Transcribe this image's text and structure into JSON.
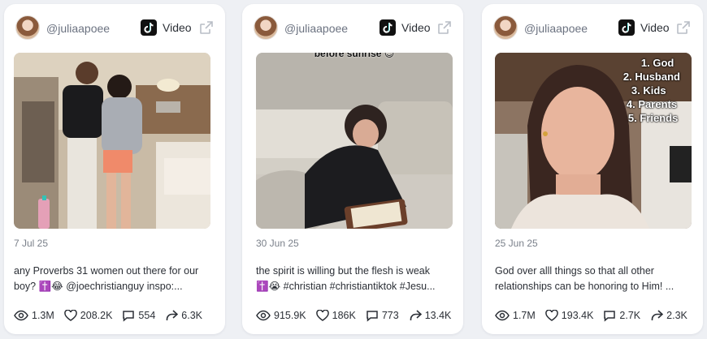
{
  "cards": [
    {
      "handle": "@juliaapoee",
      "type_label": "Video",
      "date": "7 Jul 25",
      "caption_1": "any Proverbs 31 women out there for our",
      "caption_2": "boy? ✝️😂 @joechristianguy inspo:...",
      "overlay_text": "",
      "views": "1.3M",
      "likes": "208.2K",
      "comments": "554",
      "shares": "6.3K"
    },
    {
      "handle": "@juliaapoee",
      "type_label": "Video",
      "date": "30 Jun 25",
      "caption_1": "the spirit is willing but the flesh is weak",
      "caption_2": "✝️😭 #christian #christiantiktok #Jesu...",
      "overlay_text": "before sunrise 😉",
      "views": "915.9K",
      "likes": "186K",
      "comments": "773",
      "shares": "13.4K"
    },
    {
      "handle": "@juliaapoee",
      "type_label": "Video",
      "date": "25 Jun 25",
      "caption_1": "God over alll things so that all other",
      "caption_2": "relationships can be honoring to Him! ...",
      "overlay_list": [
        "1. God",
        "2. Husband",
        "3. Kids",
        "4. Parents",
        "5. Friends"
      ],
      "views": "1.7M",
      "likes": "193.4K",
      "comments": "2.7K",
      "shares": "2.3K"
    }
  ],
  "icons": {
    "platform": "tiktok-icon",
    "open": "external-link-icon",
    "views": "eye-icon",
    "likes": "heart-icon",
    "comments": "comment-icon",
    "shares": "share-icon"
  }
}
